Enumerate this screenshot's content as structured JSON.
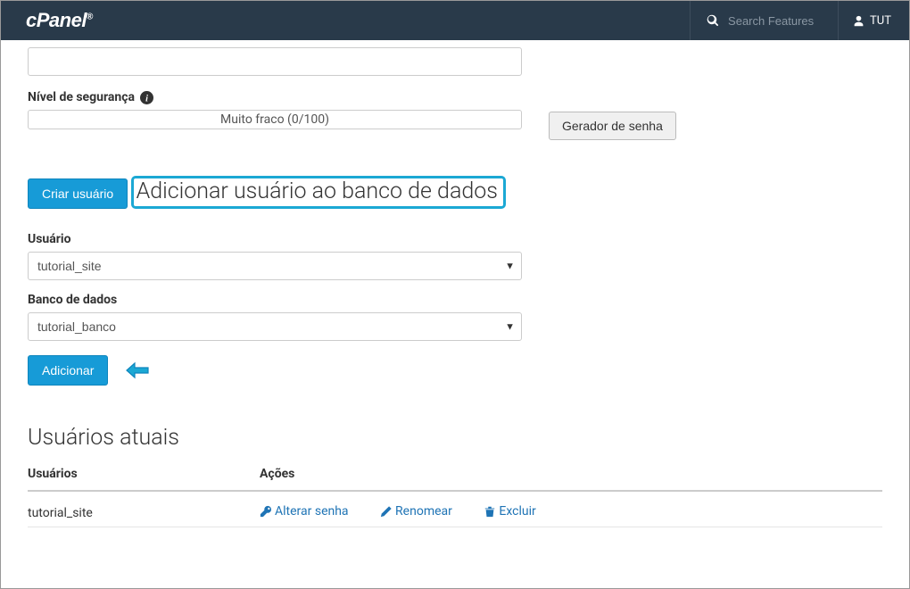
{
  "header": {
    "logo_text": "cPanel",
    "search_placeholder": "Search Features",
    "user_label": "TUT"
  },
  "security": {
    "label": "Nível de segurança",
    "strength_text": "Muito fraco (0/100)",
    "generator_btn": "Gerador de senha"
  },
  "create_user_btn": "Criar usuário",
  "add_section": {
    "heading": "Adicionar usuário ao banco de dados",
    "user_label": "Usuário",
    "user_selected": "tutorial_site",
    "db_label": "Banco de dados",
    "db_selected": "tutorial_banco",
    "add_btn": "Adicionar"
  },
  "current_users": {
    "heading": "Usuários atuais",
    "col_users": "Usuários",
    "col_actions": "Ações",
    "rows": [
      {
        "username": "tutorial_site",
        "action_password": "Alterar senha",
        "action_rename": "Renomear",
        "action_delete": "Excluir"
      }
    ]
  }
}
